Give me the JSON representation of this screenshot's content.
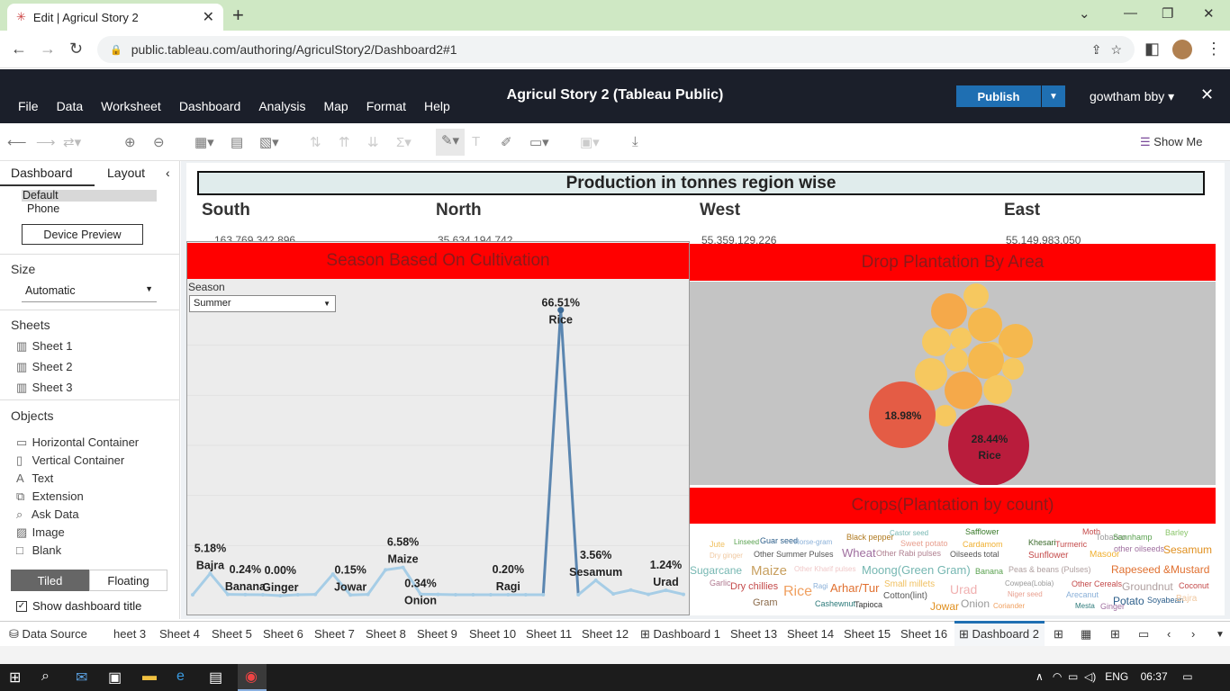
{
  "browser": {
    "tab_title": "Edit | Agricul Story 2",
    "url": "public.tableau.com/authoring/AgriculStory2/Dashboard2#1"
  },
  "app": {
    "title": "Agricul Story 2 (Tableau Public)",
    "menu": [
      "File",
      "Data",
      "Worksheet",
      "Dashboard",
      "Analysis",
      "Map",
      "Format",
      "Help"
    ],
    "publish": "Publish",
    "user": "gowtham bby",
    "show_me": "Show Me"
  },
  "left": {
    "tab_dashboard": "Dashboard",
    "tab_layout": "Layout",
    "device_default": "Default",
    "device_phone": "Phone",
    "device_preview": "Device Preview",
    "size_head": "Size",
    "size_value": "Automatic",
    "sheets_head": "Sheets",
    "sheets": [
      "Sheet 1",
      "Sheet 2",
      "Sheet 3"
    ],
    "objects_head": "Objects",
    "objects": [
      "Horizontal Container",
      "Vertical Container",
      "Text",
      "Extension",
      "Ask Data",
      "Image",
      "Blank"
    ],
    "tiled": "Tiled",
    "floating": "Floating",
    "show_title": "Show dashboard title"
  },
  "dashboard": {
    "title": "Production in tonnes region wise",
    "regions": [
      {
        "name": "South",
        "value": "163,769,342,896"
      },
      {
        "name": "North",
        "value": "35,634,194,742"
      },
      {
        "name": "West",
        "value": "55,359,129,226"
      },
      {
        "name": "East",
        "value": "55,149,983,050"
      }
    ],
    "season_header": "Season Based On Cultivation",
    "season_filter_label": "Season",
    "season_filter_value": "Summer",
    "drop_header": "Drop Plantation By Area",
    "crops_header": "Crops(Plantation by count)",
    "bubble_labels": [
      {
        "pct": "18.98%",
        "name": ""
      },
      {
        "pct": "28.44%",
        "name": "Rice"
      }
    ]
  },
  "chart_data": {
    "type": "line",
    "series": [
      {
        "values": [
          0.2,
          5.18,
          0.3,
          0.24,
          0.2,
          0.0,
          0.2,
          0.3,
          5.0,
          0.15,
          0.3,
          6.0,
          6.58,
          0.34,
          0.3,
          0.2,
          0.2,
          0.2,
          0.2,
          0.2,
          0.2,
          66.51,
          0.2,
          3.56,
          0.4,
          1.3,
          0.3,
          1.24,
          0.3
        ]
      }
    ],
    "labels": [
      {
        "index": 1,
        "pct": "5.18%",
        "crop": "Bajra"
      },
      {
        "index": 3,
        "pct": "0.24%",
        "crop": "Banana"
      },
      {
        "index": 5,
        "pct": "0.00%",
        "crop": "Ginger"
      },
      {
        "index": 9,
        "pct": "0.15%",
        "crop": "Jowar"
      },
      {
        "index": 12,
        "pct": "6.58%",
        "crop": "Maize"
      },
      {
        "index": 13,
        "pct": "0.34%",
        "crop": "Onion"
      },
      {
        "index": 18,
        "pct": "0.20%",
        "crop": "Ragi"
      },
      {
        "index": 21,
        "pct": "66.51%",
        "crop": "Rice"
      },
      {
        "index": 23,
        "pct": "3.56%",
        "crop": "Sesamum"
      },
      {
        "index": 27,
        "pct": "1.24%",
        "crop": "Urad"
      }
    ],
    "ylim": [
      0,
      70
    ]
  },
  "wordcloud": [
    {
      "t": "Jute",
      "c": "#f0c060"
    },
    {
      "t": "Linseed",
      "c": "#59a14f"
    },
    {
      "t": "Guar seed",
      "c": "#2c5e8a"
    },
    {
      "t": "Horse-gram",
      "c": "#8ab0d8"
    },
    {
      "t": "Black pepper",
      "c": "#b07a20"
    },
    {
      "t": "Castor seed",
      "c": "#76b7b2"
    },
    {
      "t": "Safflower",
      "c": "#3a7a2a"
    },
    {
      "t": "Moth",
      "c": "#c44a4a"
    },
    {
      "t": "Tobacco",
      "c": "#999999"
    },
    {
      "t": "Sannhamp",
      "c": "#59a14f"
    },
    {
      "t": "Barley",
      "c": "#8cc66d"
    },
    {
      "t": "Dry ginger",
      "c": "#f0c8a0"
    },
    {
      "t": "Other Summer Pulses",
      "c": "#555555"
    },
    {
      "t": "Sweet potato",
      "c": "#e8a090"
    },
    {
      "t": "Cardamom",
      "c": "#f0b030"
    },
    {
      "t": "Khesari",
      "c": "#3a6a2a"
    },
    {
      "t": "Turmeric",
      "c": "#c44a4a"
    },
    {
      "t": "other oilseeds",
      "c": "#a070a0"
    },
    {
      "t": "Sesamum",
      "c": "#e09020"
    },
    {
      "t": "Wheat",
      "c": "#a070a0"
    },
    {
      "t": "Other Rabi pulses",
      "c": "#b08090"
    },
    {
      "t": "Oilseeds total",
      "c": "#555555"
    },
    {
      "t": "Sunflower",
      "c": "#c44a4a"
    },
    {
      "t": "Masoor",
      "c": "#f0b030"
    },
    {
      "t": "Sugarcane",
      "c": "#76b7b2"
    },
    {
      "t": "Maize",
      "c": "#c8a060"
    },
    {
      "t": "Other Kharif pulses",
      "c": "#f0c8c8"
    },
    {
      "t": "Moong(Green Gram)",
      "c": "#76b7b2"
    },
    {
      "t": "Banana",
      "c": "#59a14f"
    },
    {
      "t": "Peas & beans (Pulses)",
      "c": "#b0a0a0"
    },
    {
      "t": "Rapeseed &Mustard",
      "c": "#e07030"
    },
    {
      "t": "Garlic",
      "c": "#b07a90"
    },
    {
      "t": "Dry chillies",
      "c": "#c44a4a"
    },
    {
      "t": "Rice",
      "c": "#f0a060"
    },
    {
      "t": "Ragi",
      "c": "#8ab0d8"
    },
    {
      "t": "Arhar/Tur",
      "c": "#e07030"
    },
    {
      "t": "Small millets",
      "c": "#f0c060"
    },
    {
      "t": "Cowpea(Lobia)",
      "c": "#999999"
    },
    {
      "t": "Other Cereals",
      "c": "#c44a4a"
    },
    {
      "t": "Groundnut",
      "c": "#b0a0a0"
    },
    {
      "t": "Coconut",
      "c": "#c44a4a"
    },
    {
      "t": "Gram",
      "c": "#8a6a4a"
    },
    {
      "t": "Cashewnut",
      "c": "#2c7a7a"
    },
    {
      "t": "Tapioca",
      "c": "#333333"
    },
    {
      "t": "Cotton(lint)",
      "c": "#555555"
    },
    {
      "t": "Urad",
      "c": "#f0b0b0"
    },
    {
      "t": "Niger seed",
      "c": "#e8a090"
    },
    {
      "t": "Arecanut",
      "c": "#8ab0d8"
    },
    {
      "t": "Potato",
      "c": "#2c5e8a"
    },
    {
      "t": "Soyabean",
      "c": "#2c5e8a"
    },
    {
      "t": "Bajra",
      "c": "#f0c8a0"
    },
    {
      "t": "Jowar",
      "c": "#e09020"
    },
    {
      "t": "Onion",
      "c": "#999999"
    },
    {
      "t": "Coriander",
      "c": "#f0a060"
    },
    {
      "t": "Mesta",
      "c": "#2c7a7a"
    },
    {
      "t": "Ginger",
      "c": "#a070a0"
    }
  ],
  "sheet_tabs": [
    "Data Source",
    "heet 3",
    "Sheet 4",
    "Sheet 5",
    "Sheet 6",
    "Sheet 7",
    "Sheet 8",
    "Sheet 9",
    "Sheet 10",
    "Sheet 11",
    "Sheet 12",
    "Dashboard 1",
    "Sheet 13",
    "Sheet 14",
    "Sheet 15",
    "Sheet 16",
    "Dashboard 2"
  ],
  "taskbar": {
    "lang": "ENG",
    "time": "06:37"
  }
}
